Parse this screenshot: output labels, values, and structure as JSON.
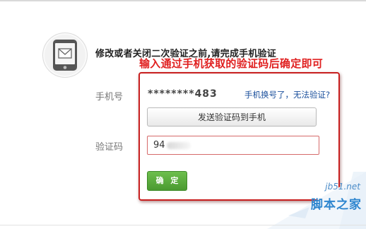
{
  "heading": "修改或者关闭二次验证之前,请完成手机验证",
  "annotation": "输入通过手机获取的验证码后确定即可",
  "phone_row": {
    "label": "手机号",
    "number": "********483",
    "change_link": "手机换号了，无法验证?"
  },
  "send_code_button": "发送验证码到手机",
  "code_row": {
    "label": "验证码",
    "value": "94"
  },
  "confirm_button": "确 定",
  "watermark": {
    "url": "jb51.net",
    "site": "脚本之家"
  },
  "colors": {
    "annotation": "#e02020",
    "highlight_box": "#c81e1e",
    "link": "#1a4f9c",
    "confirm": "#4a9a30",
    "watermark": "#2f86cf"
  },
  "icons": {
    "verify": "phone-message-icon"
  }
}
